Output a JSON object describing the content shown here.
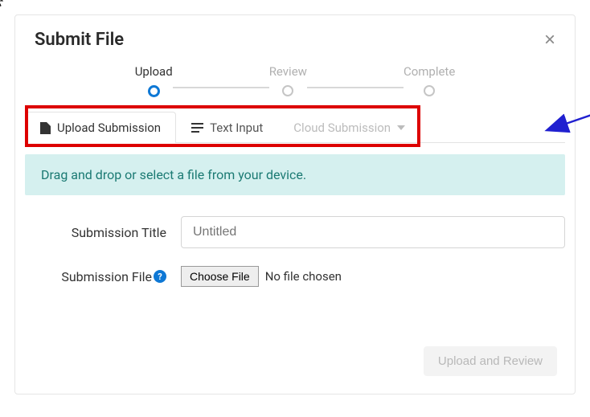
{
  "header": {
    "title": "Submit File",
    "close_label": "×"
  },
  "stepper": {
    "steps": [
      "Upload",
      "Review",
      "Complete"
    ],
    "current_index": 0
  },
  "tabs": {
    "upload": "Upload Submission",
    "text": "Text Input",
    "cloud": "Cloud Submission"
  },
  "dropzone": {
    "text": "Drag and drop or select a file from your device."
  },
  "form": {
    "title_label": "Submission Title",
    "title_placeholder": "Untitled",
    "file_label": "Submission File",
    "choose_file_label": "Choose File",
    "no_file_text": "No file chosen"
  },
  "footer": {
    "submit_label": "Upload and Review"
  }
}
